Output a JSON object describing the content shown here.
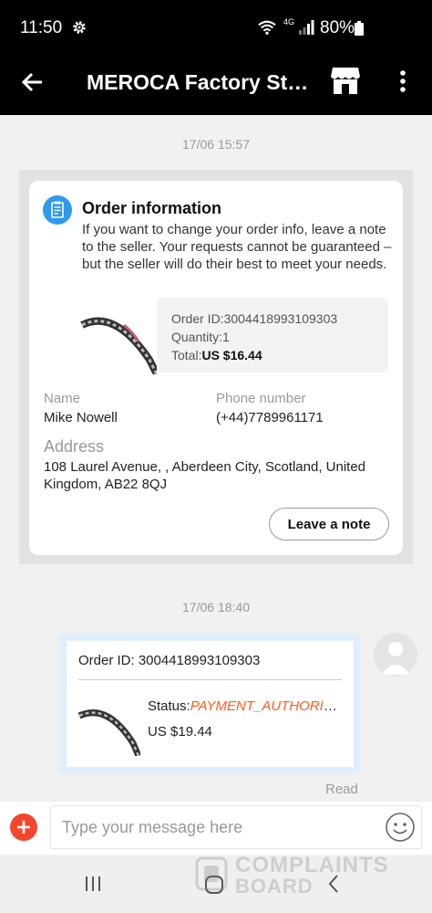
{
  "status_bar": {
    "time": "11:50",
    "network": "4G",
    "battery": "80%"
  },
  "header": {
    "title": "MEROCA Factory Sto..."
  },
  "conversation": {
    "timestamp_1": "17/06 15:57",
    "order_info": {
      "title": "Order information",
      "description": "If you want to change your order info, leave a note to the seller. Your requests cannot be guaranteed – but the seller will do their best to meet your needs.",
      "order_id": "Order ID:3004418993109303",
      "quantity": "Quantity:1",
      "total_label": "Total:",
      "total_value": "US $16.44",
      "name_label": "Name",
      "name_value": "Mike Nowell",
      "phone_label": "Phone number",
      "phone_value": "(+44)7789961171",
      "address_label": "Address",
      "address_value": "108 Laurel Avenue, , Aberdeen City, Scotland, United Kingdom, AB22 8QJ",
      "leave_note_label": "Leave a note"
    },
    "timestamp_2": "17/06 18:40",
    "message": {
      "order_id": "Order ID: 3004418993109303",
      "status_label": "Status:",
      "status_value": "PAYMENT_AUTHORIZATION",
      "price": "US $19.44",
      "read_receipt": "Read"
    }
  },
  "composer": {
    "placeholder": "Type your message here"
  },
  "watermark": {
    "line1": "COMPLAINTS",
    "line2": "BOARD"
  },
  "colors": {
    "accent": "#f2472b",
    "status_orange": "#ff5a1f",
    "info_blue": "#2d9af0"
  }
}
